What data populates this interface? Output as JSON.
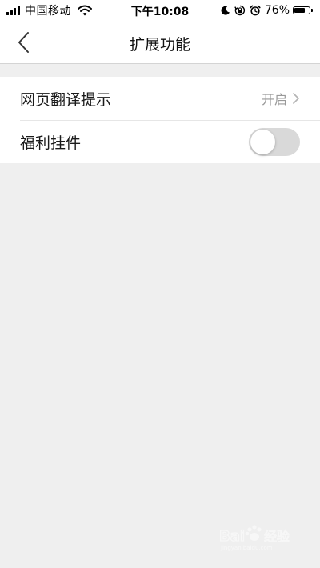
{
  "status_bar": {
    "carrier": "中国移动",
    "time": "下午10:08",
    "battery_percent": "76%",
    "battery_level": 0.76,
    "icons": [
      "signal-icon",
      "wifi-icon",
      "moon-icon",
      "rotation-lock-icon",
      "alarm-icon",
      "battery-icon"
    ]
  },
  "nav": {
    "title": "扩展功能",
    "back_icon": "chevron-left-icon"
  },
  "settings": {
    "items": [
      {
        "label": "网页翻译提示",
        "value": "开启",
        "icon": "chevron-right-icon"
      },
      {
        "label": "福利挂件",
        "toggle_on": false
      }
    ]
  },
  "colors": {
    "background": "#efefef",
    "surface": "#ffffff",
    "secondary_text": "#999999",
    "toggle_off": "#d9d9d9"
  },
  "watermark": {
    "logo": "Baidu 经验"
  }
}
